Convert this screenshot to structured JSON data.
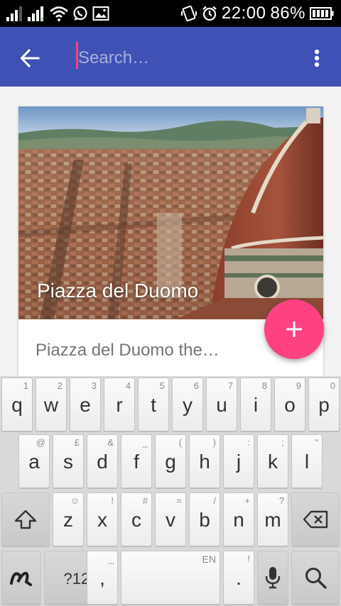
{
  "status_bar": {
    "time": "22:00",
    "battery": "86%"
  },
  "app_bar": {
    "search_placeholder": "Search…",
    "accent": "#3f51b5",
    "caret_color": "#ff4081"
  },
  "card": {
    "title": "Piazza del Duomo",
    "description": "Piazza del Duomo the…"
  },
  "fab": {
    "color": "#ff4081",
    "icon": "plus-icon"
  },
  "keyboard": {
    "row1": [
      {
        "label": "q",
        "hint": "1"
      },
      {
        "label": "w",
        "hint": "2"
      },
      {
        "label": "e",
        "hint": "3"
      },
      {
        "label": "r",
        "hint": "4"
      },
      {
        "label": "t",
        "hint": "5"
      },
      {
        "label": "y",
        "hint": "6"
      },
      {
        "label": "u",
        "hint": "7"
      },
      {
        "label": "i",
        "hint": "8"
      },
      {
        "label": "o",
        "hint": "9"
      },
      {
        "label": "p",
        "hint": "0"
      }
    ],
    "row2": [
      {
        "label": "a",
        "hint": "@"
      },
      {
        "label": "s",
        "hint": "£"
      },
      {
        "label": "d",
        "hint": "&"
      },
      {
        "label": "f",
        "hint": "_"
      },
      {
        "label": "g",
        "hint": "("
      },
      {
        "label": "h",
        "hint": ")"
      },
      {
        "label": "j",
        "hint": ":"
      },
      {
        "label": "k",
        "hint": ";"
      },
      {
        "label": "l",
        "hint": "\""
      }
    ],
    "row3": [
      {
        "label": "z",
        "hint": "!"
      },
      {
        "label": "x",
        "hint": "#"
      },
      {
        "label": "c",
        "hint": "="
      },
      {
        "label": "v",
        "hint": "/"
      },
      {
        "label": "b",
        "hint": "+"
      },
      {
        "label": "n",
        "hint": "?"
      },
      {
        "label": "m",
        "hint": ""
      }
    ],
    "z_extra_hint": "☺",
    "symbols_label": "?123",
    "comma_label": ",",
    "comma_hint": "_",
    "space_hint": "EN",
    "period_label": ".",
    "period_hint": "!"
  }
}
